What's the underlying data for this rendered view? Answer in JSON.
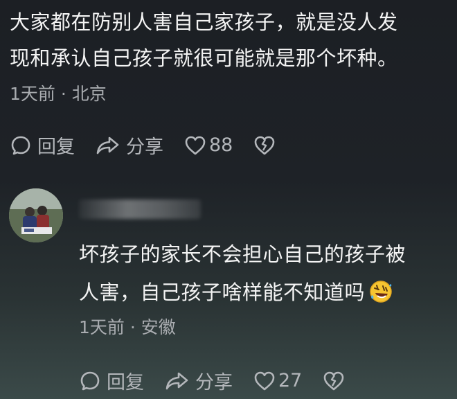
{
  "top_comment": {
    "line1": "大家都在防别人害自己家孩子，就是没人发",
    "line2": "现和承认自己孩子就很可能就是那个坏种。",
    "meta": "1天前 · 北京",
    "actions": {
      "reply_label": "回复",
      "share_label": "分享",
      "like_count": "88"
    }
  },
  "reply_comment": {
    "line1": "坏孩子的家长不会担心自己的孩子被",
    "line2": "人害，自己孩子啥样能不知道吗",
    "emoji": "rolling-on-floor-laughing",
    "meta": "1天前 · 安徽",
    "actions": {
      "reply_label": "回复",
      "share_label": "分享",
      "like_count": "27"
    }
  },
  "colors": {
    "text": "#f4f4f4",
    "muted": "#a9acb0",
    "icon": "#b4b7bb"
  }
}
